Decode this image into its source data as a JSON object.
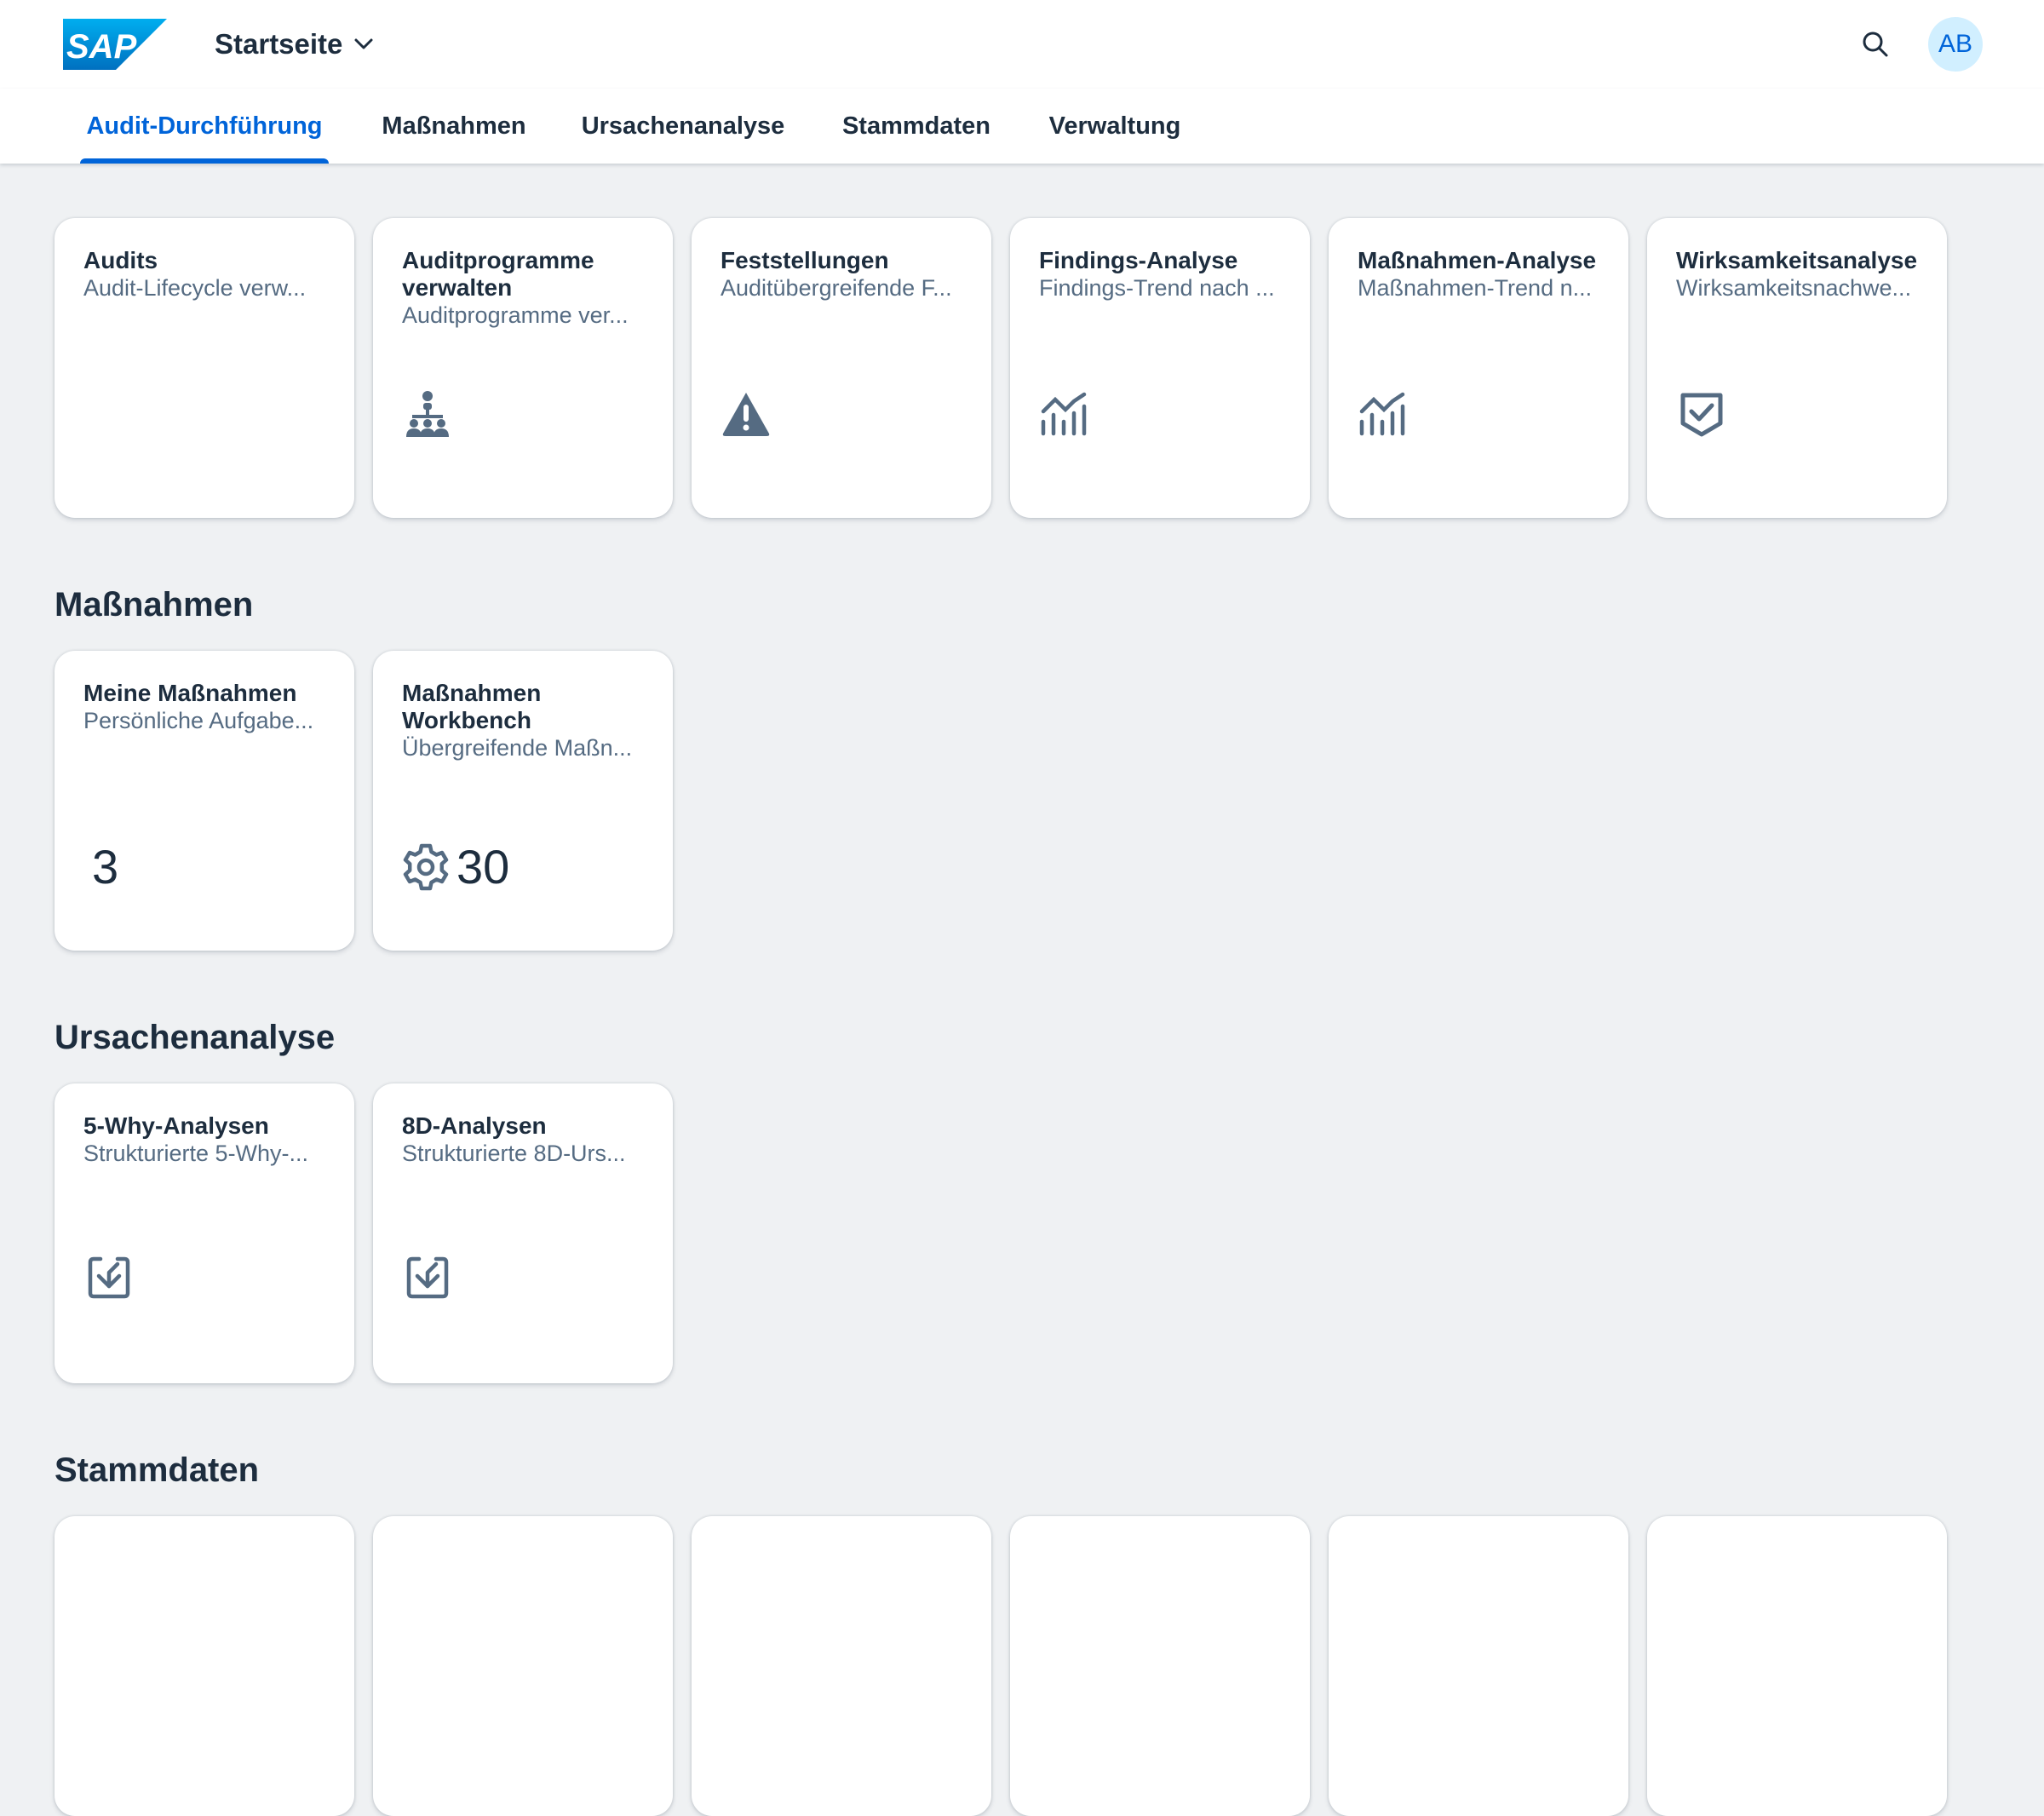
{
  "shell": {
    "logo_text": "SAP",
    "home_title": "Startseite",
    "avatar_initials": "AB",
    "colors": {
      "logo_blue": "#0a6ed1",
      "accent": "#0064d9",
      "avatar_bg": "#d1efff"
    }
  },
  "tabs": [
    {
      "label": "Audit-Durchführung",
      "active": true
    },
    {
      "label": "Maßnahmen",
      "active": false
    },
    {
      "label": "Ursachenanalyse",
      "active": false
    },
    {
      "label": "Stammdaten",
      "active": false
    },
    {
      "label": "Verwaltung",
      "active": false
    }
  ],
  "sections": {
    "audit": {
      "tiles": [
        {
          "title": "Audits",
          "subtitle": "Audit-Lifecycle verw...",
          "icon": "none"
        },
        {
          "title": "Auditprogramme verwalten",
          "subtitle": "Auditprogramme ver...",
          "icon": "org-chart-icon"
        },
        {
          "title": "Feststellungen",
          "subtitle": "Auditübergreifende F...",
          "icon": "warning-icon"
        },
        {
          "title": "Findings-Analyse",
          "subtitle": "Findings-Trend nach ...",
          "icon": "trend-chart-icon"
        },
        {
          "title": "Maßnahmen-Analyse",
          "subtitle": "Maßnahmen-Trend n...",
          "icon": "trend-chart-icon"
        },
        {
          "title": "Wirksamkeitsanalyse",
          "subtitle": "Wirksamkeitsnachwe...",
          "icon": "shield-check-icon"
        }
      ]
    },
    "massnahmen": {
      "title": "Maßnahmen",
      "tiles": [
        {
          "title": "Meine Maßnahmen",
          "subtitle": "Persönliche Aufgabe...",
          "kpi": "3",
          "icon": "none"
        },
        {
          "title": "Maßnahmen Workbench",
          "subtitle": "Übergreifende Maßn...",
          "kpi": "30",
          "icon": "gear-icon"
        }
      ]
    },
    "ursachen": {
      "title": "Ursachenanalyse",
      "tiles": [
        {
          "title": "5-Why-Analysen",
          "subtitle": "Strukturierte 5-Why-...",
          "icon": "inbox-download-icon"
        },
        {
          "title": "8D-Analysen",
          "subtitle": "Strukturierte 8D-Urs...",
          "icon": "inbox-download-icon"
        }
      ]
    },
    "stammdaten": {
      "title": "Stammdaten"
    }
  }
}
